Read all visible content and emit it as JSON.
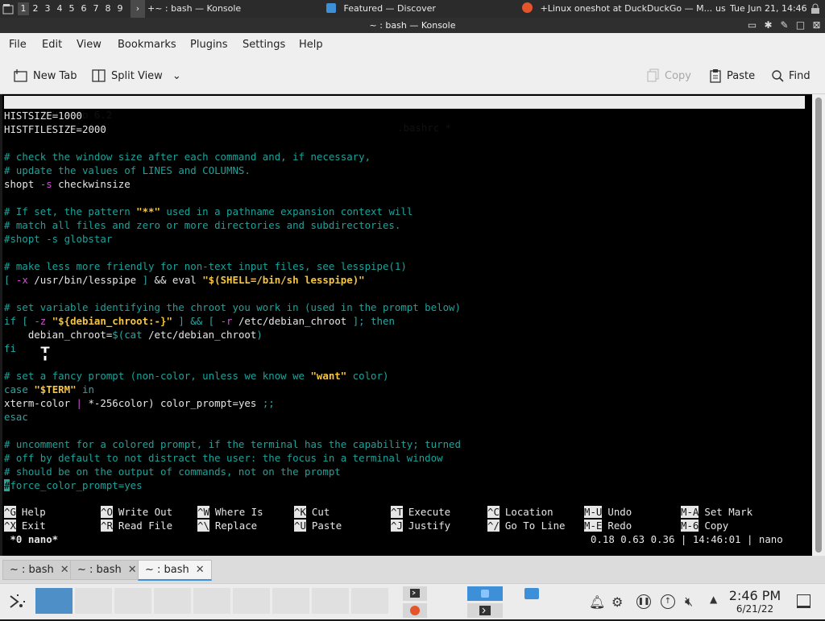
{
  "top_panel": {
    "workspaces": [
      "1",
      "2",
      "3",
      "4",
      "5",
      "6",
      "7",
      "8",
      "9"
    ],
    "tasks": [
      {
        "label": "+~ : bash — Konsole"
      },
      {
        "label": "Featured — Discover"
      },
      {
        "label": "+Linux oneshot at DuckDuckGo — M..."
      }
    ],
    "keyboard_layout": "us",
    "datetime": "Tue Jun 21, 14:46"
  },
  "window": {
    "title": "~ : bash — Konsole"
  },
  "menu": [
    "File",
    "Edit",
    "View",
    "Bookmarks",
    "Plugins",
    "Settings",
    "Help"
  ],
  "toolbar": {
    "new_tab": "New Tab",
    "split_view": "Split View",
    "copy": "Copy",
    "paste": "Paste",
    "find": "Find"
  },
  "nano": {
    "version": "  GNU nano 6.2",
    "filename": ".bashrc *",
    "shortcuts_row1": [
      {
        "key": "^G",
        "label": "Help"
      },
      {
        "key": "^O",
        "label": "Write Out"
      },
      {
        "key": "^W",
        "label": "Where Is"
      },
      {
        "key": "^K",
        "label": "Cut"
      },
      {
        "key": "^T",
        "label": "Execute"
      },
      {
        "key": "^C",
        "label": "Location"
      },
      {
        "key": "M-U",
        "label": "Undo"
      },
      {
        "key": "M-A",
        "label": "Set Mark"
      }
    ],
    "shortcuts_row2": [
      {
        "key": "^X",
        "label": "Exit"
      },
      {
        "key": "^R",
        "label": "Read File"
      },
      {
        "key": "^\\",
        "label": "Replace"
      },
      {
        "key": "^U",
        "label": "Paste"
      },
      {
        "key": "^J",
        "label": "Justify"
      },
      {
        "key": "^/",
        "label": "Go To Line"
      },
      {
        "key": "M-E",
        "label": "Redo"
      },
      {
        "key": "M-6",
        "label": "Copy"
      }
    ],
    "tmux_left": " *0 nano*",
    "tmux_right": "0.18 0.63 0.36 | 14:46:01 | nano"
  },
  "code_lines": [
    {
      "spans": [
        [
          "HISTSIZE",
          ""
        ],
        [
          "=",
          ""
        ],
        [
          "1000",
          ""
        ]
      ]
    },
    {
      "spans": [
        [
          "HISTFILESIZE",
          ""
        ],
        [
          "=",
          ""
        ],
        [
          "2000",
          ""
        ]
      ]
    },
    {
      "spans": []
    },
    {
      "spans": [
        [
          "# check the window size after each command and, if necessary,",
          "cm"
        ]
      ]
    },
    {
      "spans": [
        [
          "# update the values of LINES and COLUMNS.",
          "cm"
        ]
      ]
    },
    {
      "spans": [
        [
          "shopt ",
          ""
        ],
        [
          "-s",
          "op"
        ],
        [
          " checkwinsize",
          ""
        ]
      ]
    },
    {
      "spans": []
    },
    {
      "spans": [
        [
          "# If set, the pattern ",
          "cm"
        ],
        [
          "\"**\"",
          "strb"
        ],
        [
          " used in a pathname expansion context will",
          "cm"
        ]
      ]
    },
    {
      "spans": [
        [
          "# match all files and zero or more directories and subdirectories.",
          "cm"
        ]
      ]
    },
    {
      "spans": [
        [
          "#shopt -s globstar",
          "cm"
        ]
      ]
    },
    {
      "spans": []
    },
    {
      "spans": [
        [
          "# make less more friendly for non-text input files, see lesspipe(1)",
          "cm"
        ]
      ]
    },
    {
      "spans": [
        [
          "[ ",
          "kw"
        ],
        [
          "-x",
          "op"
        ],
        [
          " /usr/bin/lesspipe ",
          ""
        ],
        [
          "] ",
          "kw"
        ],
        [
          "&& eval ",
          ""
        ],
        [
          "\"$(SHELL=/bin/sh lesspipe)\"",
          "strb"
        ]
      ]
    },
    {
      "spans": []
    },
    {
      "spans": [
        [
          "# set variable identifying the chroot you work in (used in the prompt below)",
          "cm"
        ]
      ]
    },
    {
      "spans": [
        [
          "if ",
          "kw"
        ],
        [
          "[ ",
          "kw"
        ],
        [
          "-z",
          "op"
        ],
        [
          " ",
          ""
        ],
        [
          "\"${debian_chroot:-}\"",
          "strb"
        ],
        [
          " ] && [ ",
          "kw"
        ],
        [
          "-r",
          "op"
        ],
        [
          " /etc/debian_chroot ",
          ""
        ],
        [
          "]; then",
          "kw"
        ]
      ]
    },
    {
      "spans": [
        [
          "    debian_chroot",
          ""
        ],
        [
          "=",
          ""
        ],
        [
          "$(",
          "var"
        ],
        [
          "cat",
          "kw"
        ],
        [
          " /etc/debian_chroot",
          ""
        ],
        [
          ")",
          "var"
        ]
      ]
    },
    {
      "spans": [
        [
          "fi",
          "kw"
        ]
      ]
    },
    {
      "spans": []
    },
    {
      "spans": [
        [
          "# set a fancy prompt (non-color, unless we know we ",
          "cm"
        ],
        [
          "\"want\"",
          "strb"
        ],
        [
          " color)",
          "cm"
        ]
      ]
    },
    {
      "spans": [
        [
          "case ",
          "kw"
        ],
        [
          "\"$TERM\"",
          "strb"
        ],
        [
          " in",
          "kw"
        ]
      ]
    },
    {
      "spans": [
        [
          "xterm-color ",
          ""
        ],
        [
          "| ",
          "op"
        ],
        [
          "*-256color",
          ""
        ],
        [
          ") color_prompt",
          ""
        ],
        [
          "=",
          ""
        ],
        [
          "yes ",
          ""
        ],
        [
          ";;",
          "kw"
        ]
      ]
    },
    {
      "spans": [
        [
          "esac",
          "kw"
        ]
      ]
    },
    {
      "spans": []
    },
    {
      "spans": [
        [
          "# uncomment for a colored prompt, if the terminal has the capability; turned",
          "cm"
        ]
      ]
    },
    {
      "spans": [
        [
          "# off by default to not distract the user: the focus in a terminal window",
          "cm"
        ]
      ]
    },
    {
      "spans": [
        [
          "# should be on the output of commands, not on the prompt",
          "cm"
        ]
      ]
    },
    {
      "spans": [
        [
          "#force_color_prompt=yes",
          "cm"
        ]
      ]
    }
  ],
  "konsole_tabs": [
    {
      "label": "~ : bash",
      "active": false
    },
    {
      "label": "~ : bash",
      "active": false
    },
    {
      "label": "~ : bash",
      "active": true
    }
  ],
  "taskbar": {
    "clock_time": "2:46 PM",
    "clock_date": "6/21/22"
  }
}
